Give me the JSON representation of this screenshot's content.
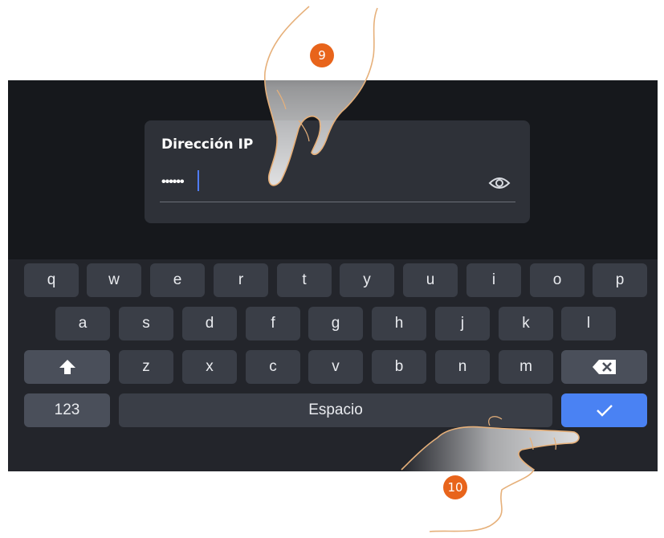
{
  "dialog": {
    "title": "Dirección IP",
    "field_value": "••••••",
    "visibility_icon": "eye-icon"
  },
  "keyboard": {
    "row1": [
      "q",
      "w",
      "e",
      "r",
      "t",
      "y",
      "u",
      "i",
      "o",
      "p"
    ],
    "row2": [
      "a",
      "s",
      "d",
      "f",
      "g",
      "h",
      "j",
      "k",
      "l"
    ],
    "row3": [
      "z",
      "x",
      "c",
      "v",
      "b",
      "n",
      "m"
    ],
    "shift_icon": "shift-up-arrow-icon",
    "backspace_icon": "backspace-icon",
    "numbers_label": "123",
    "space_label": "Espacio",
    "enter_icon": "check-icon",
    "accent_color": "#4a82f3"
  },
  "annotations": {
    "step_a": "9",
    "step_b": "10",
    "badge_color": "#e8641b"
  }
}
